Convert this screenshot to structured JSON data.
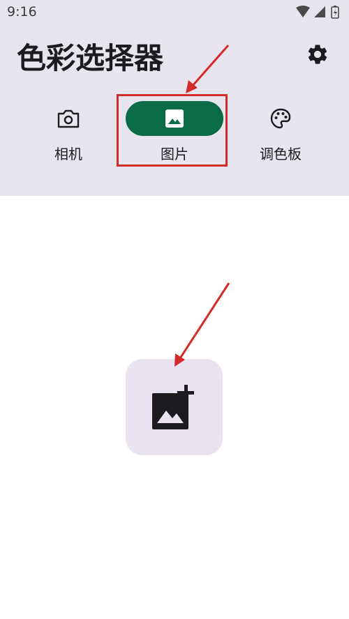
{
  "status_bar": {
    "time": "9:16",
    "icons": [
      "wifi-icon",
      "signal-icon",
      "battery-icon"
    ]
  },
  "header": {
    "title": "色彩选择器",
    "settings_icon": "gear-icon"
  },
  "tabs": [
    {
      "label": "相机",
      "icon": "camera-icon",
      "selected": false
    },
    {
      "label": "图片",
      "icon": "image-icon",
      "selected": true
    },
    {
      "label": "调色板",
      "icon": "palette-icon",
      "selected": false
    }
  ],
  "main": {
    "add_image_icon": "add-photo-icon"
  },
  "colors": {
    "accent": "#0a6b47",
    "header_bg": "#e9e5ee",
    "annotation": "#d42a2a"
  }
}
